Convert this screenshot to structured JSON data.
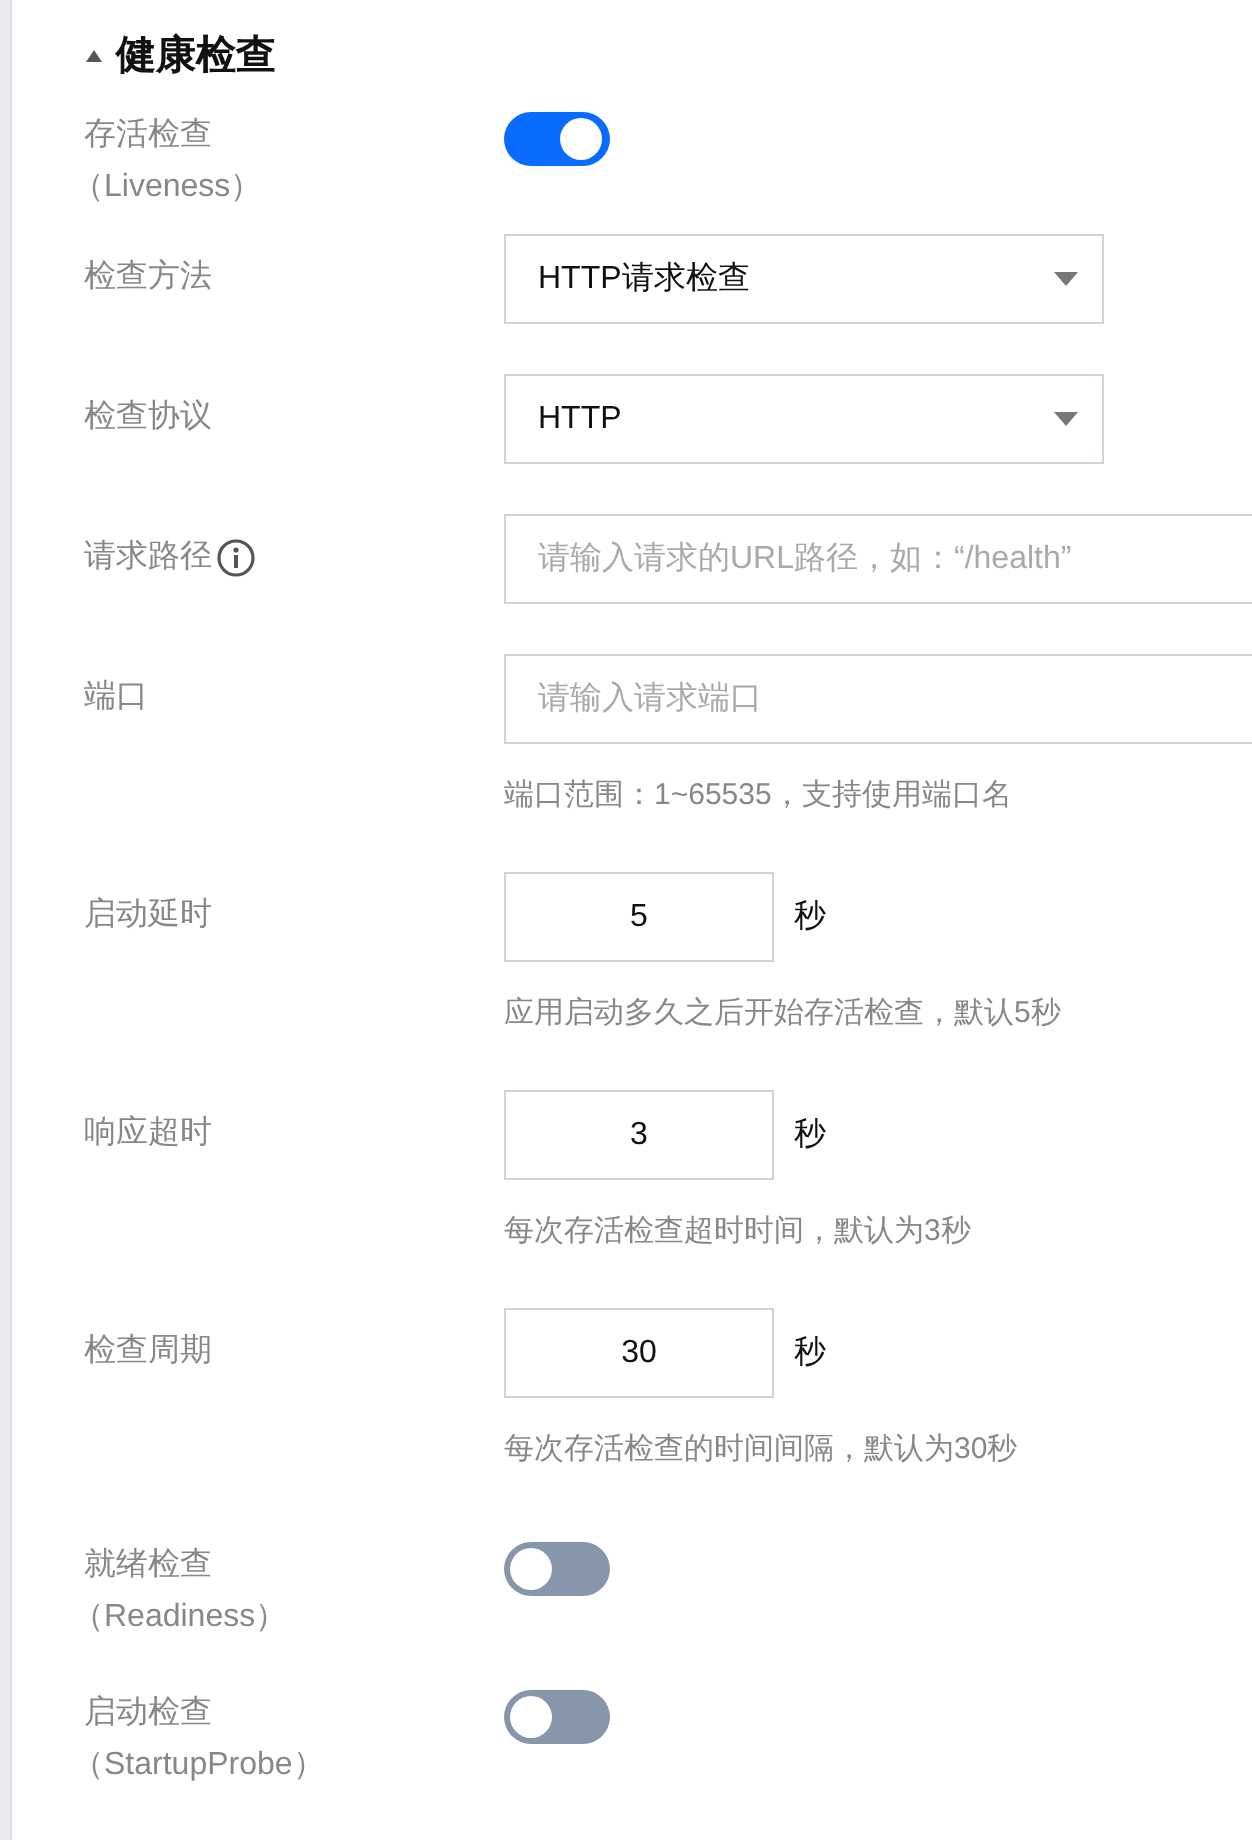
{
  "section": {
    "title": "健康检查",
    "expanded": true
  },
  "fields": [
    {
      "kind": "switch",
      "label": "存活检查",
      "sublabel": "（Liveness）",
      "on": true
    },
    {
      "kind": "select",
      "label": "检查方法",
      "value": "HTTP请求检查"
    },
    {
      "kind": "select",
      "label": "检查协议",
      "value": "HTTP"
    },
    {
      "kind": "text",
      "label": "请求路径",
      "info": true,
      "placeholder": "请输入请求的URL路径，如：“/health”"
    },
    {
      "kind": "text",
      "label": "端口",
      "placeholder": "请输入请求端口",
      "help": "端口范围：1~65535，支持使用端口名"
    },
    {
      "kind": "number",
      "label": "启动延时",
      "value": "5",
      "unit": "秒",
      "help": "应用启动多久之后开始存活检查，默认5秒"
    },
    {
      "kind": "number",
      "label": "响应超时",
      "value": "3",
      "unit": "秒",
      "help": "每次存活检查超时时间，默认为3秒"
    },
    {
      "kind": "number",
      "label": "检查周期",
      "value": "30",
      "unit": "秒",
      "help": "每次存活检查的时间间隔，默认为30秒"
    },
    {
      "kind": "switch",
      "label": "就绪检查",
      "sublabel": "（Readiness）",
      "on": false
    },
    {
      "kind": "switch",
      "label": "启动检查",
      "sublabel": "（StartupProbe）",
      "on": false
    }
  ]
}
